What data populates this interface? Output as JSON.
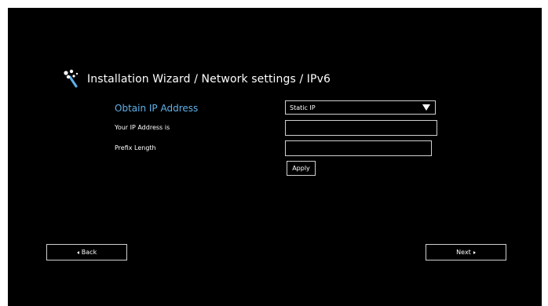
{
  "wizard": {
    "title": "Installation Wizard / Network settings / IPv6",
    "icon": "magic-wand-icon"
  },
  "form": {
    "obtain_label": "Obtain IP Address",
    "obtain_value": "Static IP",
    "ip_label": "Your IP Address is",
    "ip_value": "",
    "prefix_label": "Prefix Length",
    "prefix_value": "",
    "apply_label": "Apply"
  },
  "nav": {
    "back_label": "Back",
    "next_label": "Next"
  },
  "colors": {
    "background": "#000000",
    "accent_label": "#5fb2ea",
    "border": "#cfcfcf",
    "text": "#ffffff"
  }
}
